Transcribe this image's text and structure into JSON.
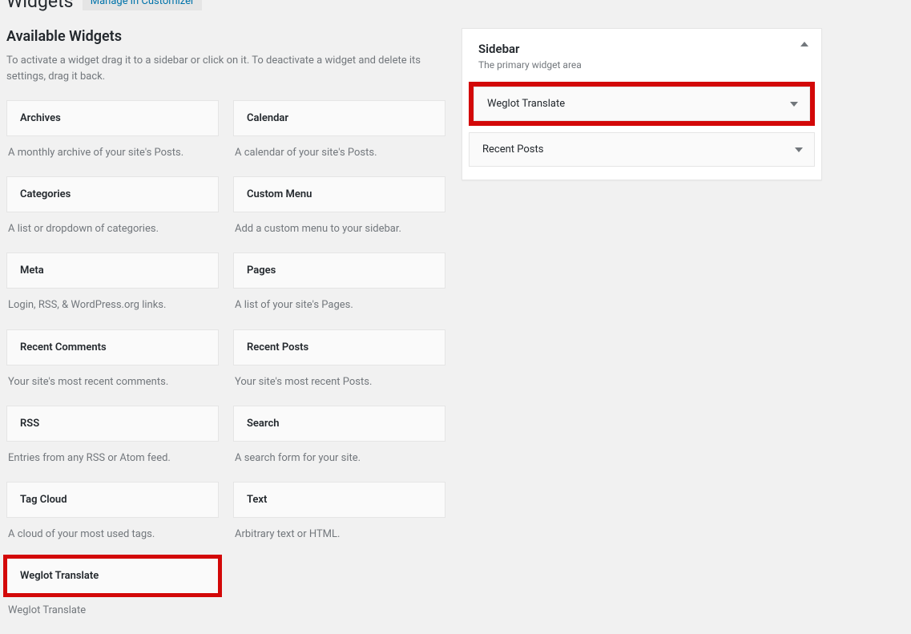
{
  "header": {
    "page_title": "Widgets",
    "customizer_link": "Manage in Customizer"
  },
  "available": {
    "title": "Available Widgets",
    "description": "To activate a widget drag it to a sidebar or click on it. To deactivate a widget and delete its settings, drag it back.",
    "widgets": [
      {
        "name": "Archives",
        "desc": "A monthly archive of your site's Posts."
      },
      {
        "name": "Calendar",
        "desc": "A calendar of your site's Posts."
      },
      {
        "name": "Categories",
        "desc": "A list or dropdown of categories."
      },
      {
        "name": "Custom Menu",
        "desc": "Add a custom menu to your sidebar."
      },
      {
        "name": "Meta",
        "desc": "Login, RSS, & WordPress.org links."
      },
      {
        "name": "Pages",
        "desc": "A list of your site's Pages."
      },
      {
        "name": "Recent Comments",
        "desc": "Your site's most recent comments."
      },
      {
        "name": "Recent Posts",
        "desc": "Your site's most recent Posts."
      },
      {
        "name": "RSS",
        "desc": "Entries from any RSS or Atom feed."
      },
      {
        "name": "Search",
        "desc": "A search form for your site."
      },
      {
        "name": "Tag Cloud",
        "desc": "A cloud of your most used tags."
      },
      {
        "name": "Text",
        "desc": "Arbitrary text or HTML."
      },
      {
        "name": "Weglot Translate",
        "desc": "Weglot Translate",
        "highlighted": true
      }
    ]
  },
  "sidebar": {
    "title": "Sidebar",
    "description": "The primary widget area",
    "widgets": [
      {
        "name": "Weglot Translate",
        "highlighted": true
      },
      {
        "name": "Recent Posts",
        "highlighted": false
      }
    ]
  }
}
